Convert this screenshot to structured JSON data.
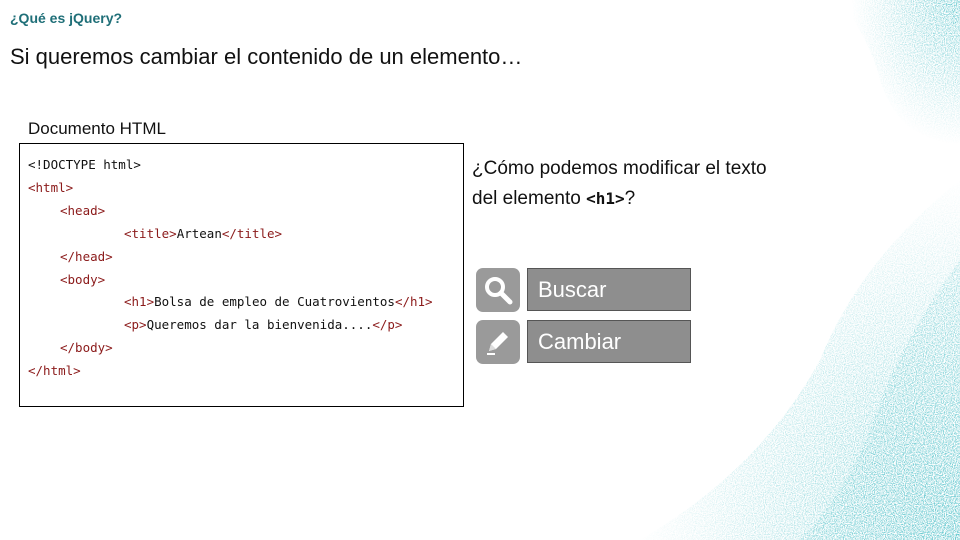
{
  "slide": {
    "kicker": "¿Qué es jQuery?",
    "headline": "Si queremos cambiar el contenido de un elemento…"
  },
  "document": {
    "label": "Documento HTML",
    "lines": [
      {
        "tag_open": "<!DOCTYPE html>",
        "text": "",
        "tag_close": ""
      },
      {
        "tag_open": "<html>",
        "text": "",
        "tag_close": ""
      },
      {
        "tag_open": "<head>",
        "text": "",
        "tag_close": ""
      },
      {
        "tag_open": "<title>",
        "text": "Artean",
        "tag_close": "</title>"
      },
      {
        "tag_open": "</head>",
        "text": "",
        "tag_close": ""
      },
      {
        "tag_open": "<body>",
        "text": "",
        "tag_close": ""
      },
      {
        "tag_open": "<h1>",
        "text": "Bolsa de empleo de Cuatrovientos",
        "tag_close": "</h1>"
      },
      {
        "tag_open": "<p>",
        "text": "Queremos dar la bienvenida....",
        "tag_close": "</p>"
      },
      {
        "tag_open": "</body>",
        "text": "",
        "tag_close": ""
      },
      {
        "tag_open": "</html>",
        "text": "",
        "tag_close": ""
      }
    ]
  },
  "question": {
    "line1": "¿Cómo podemos modificar el texto",
    "line2_prefix": "del elemento ",
    "line2_code": "<h1>",
    "line2_suffix": "?"
  },
  "actions": {
    "search_label": "Buscar",
    "change_label": "Cambiar",
    "search_icon": "magnifier-icon",
    "change_icon": "pencil-icon"
  },
  "colors": {
    "kicker": "#1f6f78",
    "tag": "#8b1a1a",
    "button_bg": "#8e8e8e",
    "icon_bg": "#9a9a9a"
  }
}
